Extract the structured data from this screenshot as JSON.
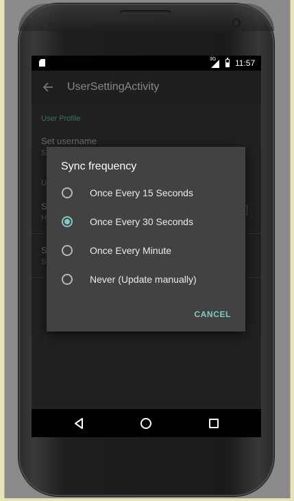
{
  "status_bar": {
    "net_type": "3G",
    "time": "11:57"
  },
  "app_bar": {
    "title": "UserSettingActivity"
  },
  "settings": {
    "category_1": "User Profile",
    "pref_1_title": "Set username",
    "pref_1_summary": "S",
    "category_2": "U",
    "pref_2_title": "S",
    "pref_2_summary": "H",
    "pref_3_title": "S",
    "pref_3_summary": "S"
  },
  "dialog": {
    "title": "Sync frequency",
    "options": [
      {
        "label": "Once Every 15 Seconds",
        "checked": false
      },
      {
        "label": "Once Every 30 Seconds",
        "checked": true
      },
      {
        "label": "Once Every Minute",
        "checked": false
      },
      {
        "label": "Never (Update manually)",
        "checked": false
      }
    ],
    "cancel_label": "CANCEL"
  },
  "colors": {
    "accent": "#80cbc4",
    "dialog_bg": "#424242",
    "screen_bg": "#212121"
  },
  "icons": [
    "sd-card-icon",
    "signal-icon",
    "battery-icon",
    "back-arrow-icon",
    "nav-back-icon",
    "nav-home-icon",
    "nav-recents-icon"
  ]
}
